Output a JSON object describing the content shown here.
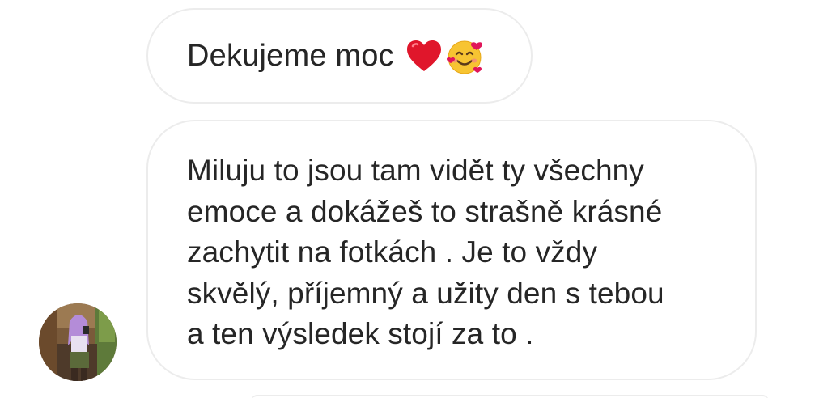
{
  "messages": [
    {
      "text": "Dekujeme moc",
      "emojis": [
        "red-heart-emoji",
        "smiling-face-with-hearts-emoji"
      ]
    },
    {
      "lines": [
        "Miluju to jsou tam vidět ty všechny",
        "emoce a dokážeš to strašně krásné",
        "zachytit na fotkách . Je to vždy",
        "skvělý, příjemný a užity den s tebou",
        "a ten výsledek stojí za to ."
      ]
    }
  ],
  "colors": {
    "bubble_border": "#ececec",
    "text": "#262626",
    "heart": "#e0162b",
    "face": "#f7c432"
  }
}
